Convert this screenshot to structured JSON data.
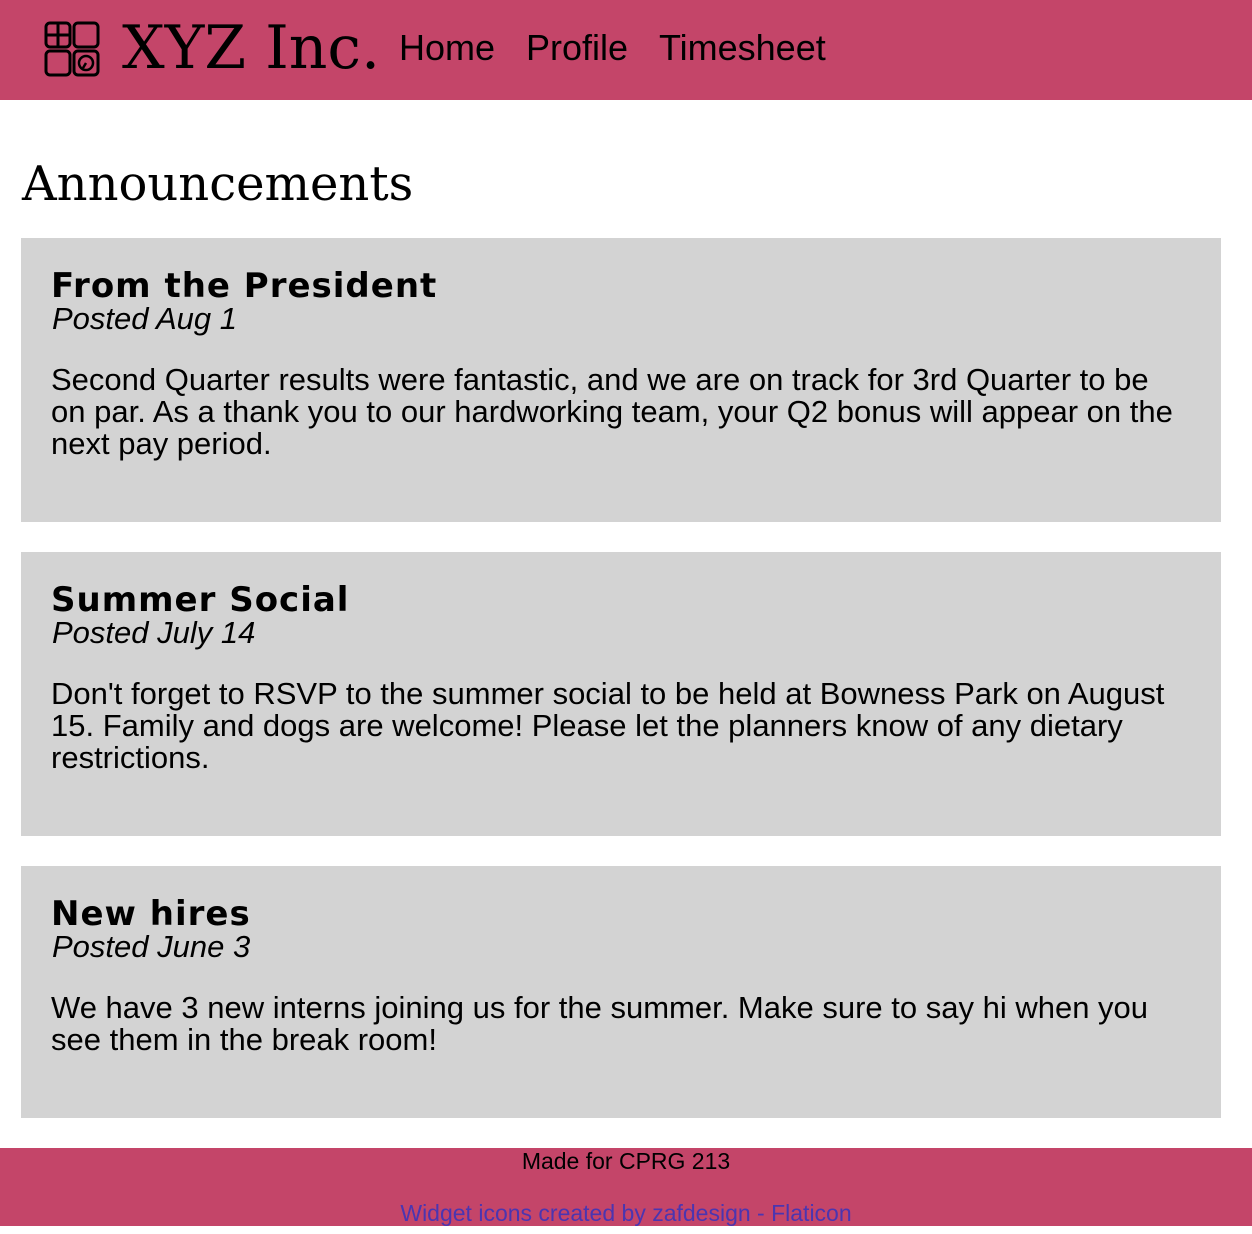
{
  "header": {
    "brand": "XYZ Inc.",
    "logo_icon": "widget-grid-icon",
    "nav": [
      {
        "label": "Home"
      },
      {
        "label": "Profile"
      },
      {
        "label": "Timesheet"
      }
    ]
  },
  "main": {
    "title": "Announcements",
    "announcements": [
      {
        "title": "From the President",
        "date": "Posted Aug 1",
        "body": "Second Quarter results were fantastic, and we are on track for 3rd Quarter to be on par. As a thank you to our hardworking team, your Q2 bonus will appear on the next pay period."
      },
      {
        "title": "Summer Social",
        "date": "Posted July 14",
        "body": "Don't forget to RSVP to the summer social to be held at Bowness Park on August 15. Family and dogs are welcome! Please let the planners know of any dietary restrictions."
      },
      {
        "title": "New hires",
        "date": "Posted June 3",
        "body": "We have 3 new interns joining us for the summer. Make sure to say hi when you see them in the break room!"
      }
    ]
  },
  "footer": {
    "text": "Made for CPRG 213",
    "credit": "Widget icons created by zafdesign - Flaticon"
  },
  "colors": {
    "header_bg": "#c44569",
    "card_bg": "#d3d3d3",
    "link": "#4b35b0"
  }
}
